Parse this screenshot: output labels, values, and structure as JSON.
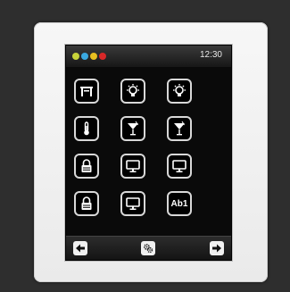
{
  "status_bar": {
    "time": "12:30",
    "indicator_colors": [
      "#c8d43a",
      "#3aa8e0",
      "#e8c020",
      "#d82828"
    ]
  },
  "tiles": [
    {
      "icon": "table-icon"
    },
    {
      "icon": "lightbulb-icon"
    },
    {
      "icon": "lightbulb-icon"
    },
    {
      "icon": "thermometer-icon"
    },
    {
      "icon": "cocktail-icon"
    },
    {
      "icon": "cocktail-icon"
    },
    {
      "icon": "lock-icon"
    },
    {
      "icon": "monitor-icon"
    },
    {
      "icon": "monitor-icon"
    },
    {
      "icon": "lock-icon"
    },
    {
      "icon": "monitor-icon"
    },
    {
      "label": "Ab1"
    }
  ],
  "navigation": {
    "back": "left-arrow-icon",
    "settings": "gears-icon",
    "forward": "right-arrow-icon"
  }
}
